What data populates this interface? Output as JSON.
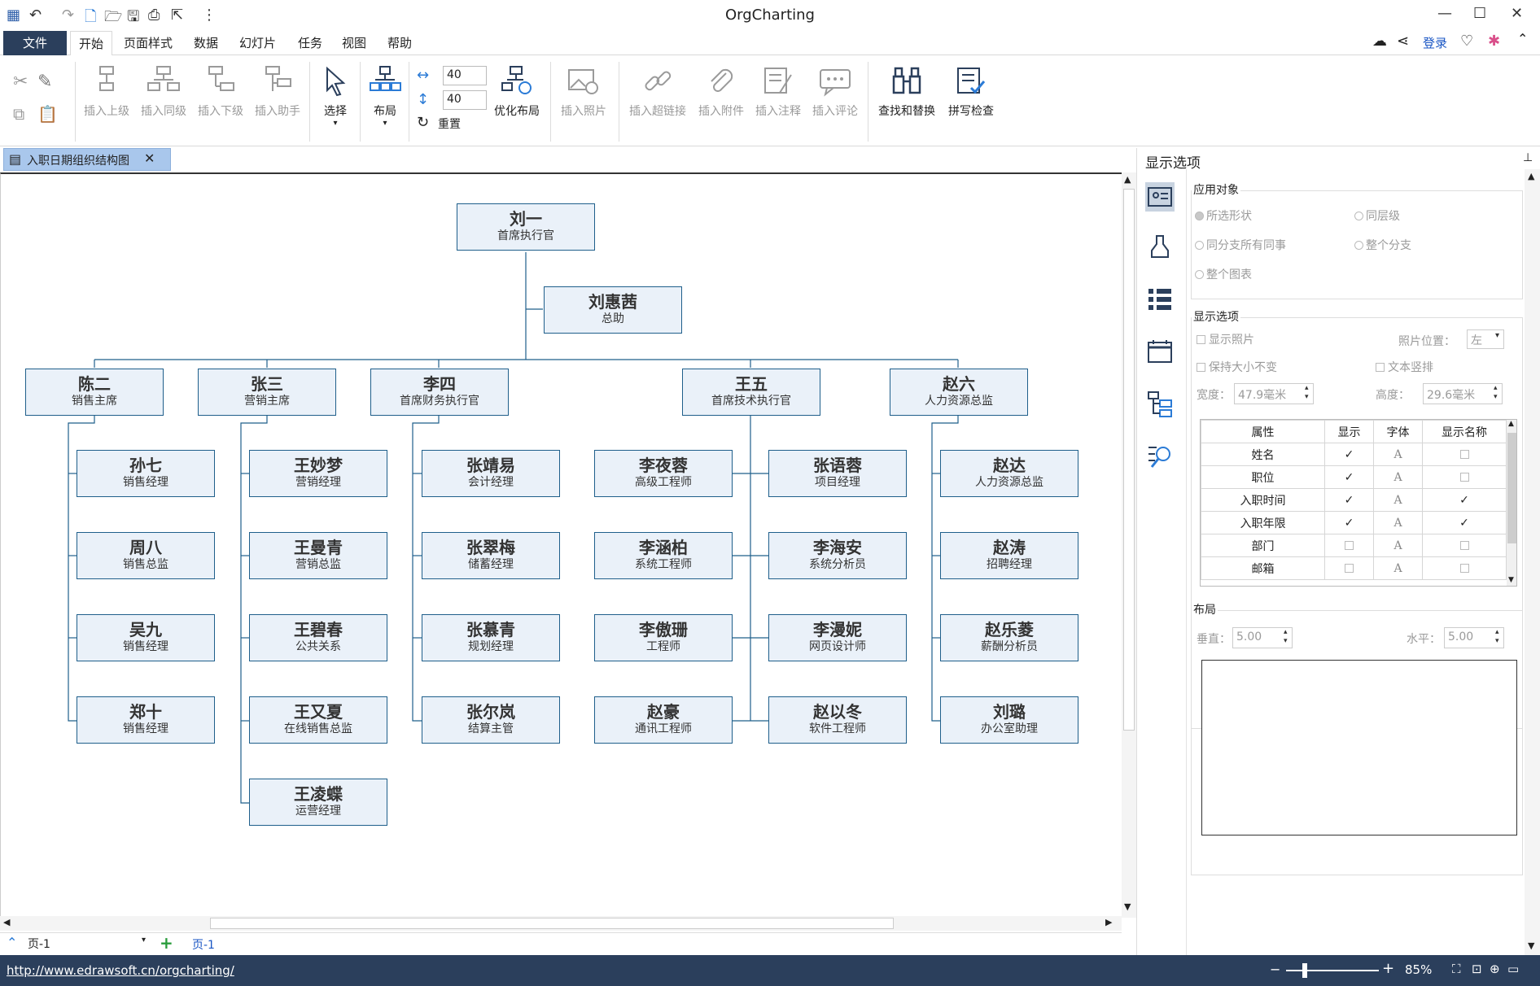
{
  "window": {
    "title": "OrgCharting",
    "minimize": "—",
    "maximize": "☐",
    "close": "✕"
  },
  "menu": {
    "file": "文件",
    "items": [
      "开始",
      "页面样式",
      "数据",
      "幻灯片",
      "任务",
      "视图",
      "帮助"
    ],
    "login": "登录"
  },
  "ribbon": {
    "insert_superior": "插入上级",
    "insert_peer": "插入同级",
    "insert_subordinate": "插入下级",
    "insert_assistant": "插入助手",
    "select": "选择",
    "layout": "布局",
    "spacing_h": "40",
    "spacing_v": "40",
    "reset": "重置",
    "optimize_layout": "优化布局",
    "insert_photo": "插入照片",
    "insert_hyperlink": "插入超链接",
    "insert_attachment": "插入附件",
    "insert_note": "插入注释",
    "insert_comment": "插入评论",
    "find_replace": "查找和替换",
    "spell_check": "拼写检查"
  },
  "doc_tab": {
    "label": "入职日期组织结构图"
  },
  "org": {
    "root": {
      "name": "刘一",
      "title": "首席执行官"
    },
    "assistant": {
      "name": "刘惠茜",
      "title": "总助"
    },
    "heads": [
      {
        "name": "陈二",
        "title": "销售主席"
      },
      {
        "name": "张三",
        "title": "营销主席"
      },
      {
        "name": "李四",
        "title": "首席财务执行官"
      },
      {
        "name": "王五",
        "title": "首席技术执行官"
      },
      {
        "name": "赵六",
        "title": "人力资源总监"
      }
    ],
    "col1": [
      {
        "name": "孙七",
        "title": "销售经理"
      },
      {
        "name": "周八",
        "title": "销售总监"
      },
      {
        "name": "吴九",
        "title": "销售经理"
      },
      {
        "name": "郑十",
        "title": "销售经理"
      }
    ],
    "col2": [
      {
        "name": "王妙梦",
        "title": "营销经理"
      },
      {
        "name": "王曼青",
        "title": "营销总监"
      },
      {
        "name": "王碧春",
        "title": "公共关系"
      },
      {
        "name": "王又夏",
        "title": "在线销售总监"
      },
      {
        "name": "王凌蝶",
        "title": "运营经理"
      }
    ],
    "col3": [
      {
        "name": "张靖易",
        "title": "会计经理"
      },
      {
        "name": "张翠梅",
        "title": "储蓄经理"
      },
      {
        "name": "张慕青",
        "title": "规划经理"
      },
      {
        "name": "张尔岚",
        "title": "结算主管"
      }
    ],
    "col4a": [
      {
        "name": "李夜蓉",
        "title": "高级工程师"
      },
      {
        "name": "李涵柏",
        "title": "系统工程师"
      },
      {
        "name": "李傲珊",
        "title": "工程师"
      },
      {
        "name": "赵豪",
        "title": "通讯工程师"
      }
    ],
    "col4b": [
      {
        "name": "张语蓉",
        "title": "项目经理"
      },
      {
        "name": "李海安",
        "title": "系统分析员"
      },
      {
        "name": "李漫妮",
        "title": "网页设计师"
      },
      {
        "name": "赵以冬",
        "title": "软件工程师"
      }
    ],
    "col5": [
      {
        "name": "赵达",
        "title": "人力资源总监"
      },
      {
        "name": "赵涛",
        "title": "招聘经理"
      },
      {
        "name": "赵乐菱",
        "title": "薪酬分析员"
      },
      {
        "name": "刘璐",
        "title": "办公室助理"
      }
    ]
  },
  "pagebar": {
    "page_select": "页-1",
    "page_tab": "页-1"
  },
  "status": {
    "url": "http://www.edrawsoft.cn/orgcharting/",
    "zoom": "85%"
  },
  "panel": {
    "title": "显示选项",
    "apply_to": {
      "title": "应用对象",
      "selected_shape": "所选形状",
      "same_level": "同层级",
      "same_branch_colleagues": "同分支所有同事",
      "whole_branch": "整个分支",
      "whole_chart": "整个图表"
    },
    "display": {
      "title": "显示选项",
      "show_photo": "显示照片",
      "photo_position_label": "照片位置：",
      "photo_position": "左",
      "keep_size": "保持大小不变",
      "vertical_text": "文本竖排",
      "width_label": "宽度：",
      "width": "47.9毫米",
      "height_label": "高度：",
      "height": "29.6毫米"
    },
    "table": {
      "headers": [
        "属性",
        "显示",
        "字体",
        "显示名称"
      ],
      "rows": [
        {
          "name": "姓名",
          "show": true,
          "show_name": false
        },
        {
          "name": "职位",
          "show": true,
          "show_name": false
        },
        {
          "name": "入职时间",
          "show": true,
          "show_name": true
        },
        {
          "name": "入职年限",
          "show": true,
          "show_name": true
        },
        {
          "name": "部门",
          "show": false,
          "show_name": false
        },
        {
          "name": "邮箱",
          "show": false,
          "show_name": false
        }
      ]
    },
    "layout": {
      "title": "布局",
      "vertical_label": "垂直：",
      "vertical": "5.00",
      "horizontal_label": "水平：",
      "horizontal": "5.00"
    }
  }
}
